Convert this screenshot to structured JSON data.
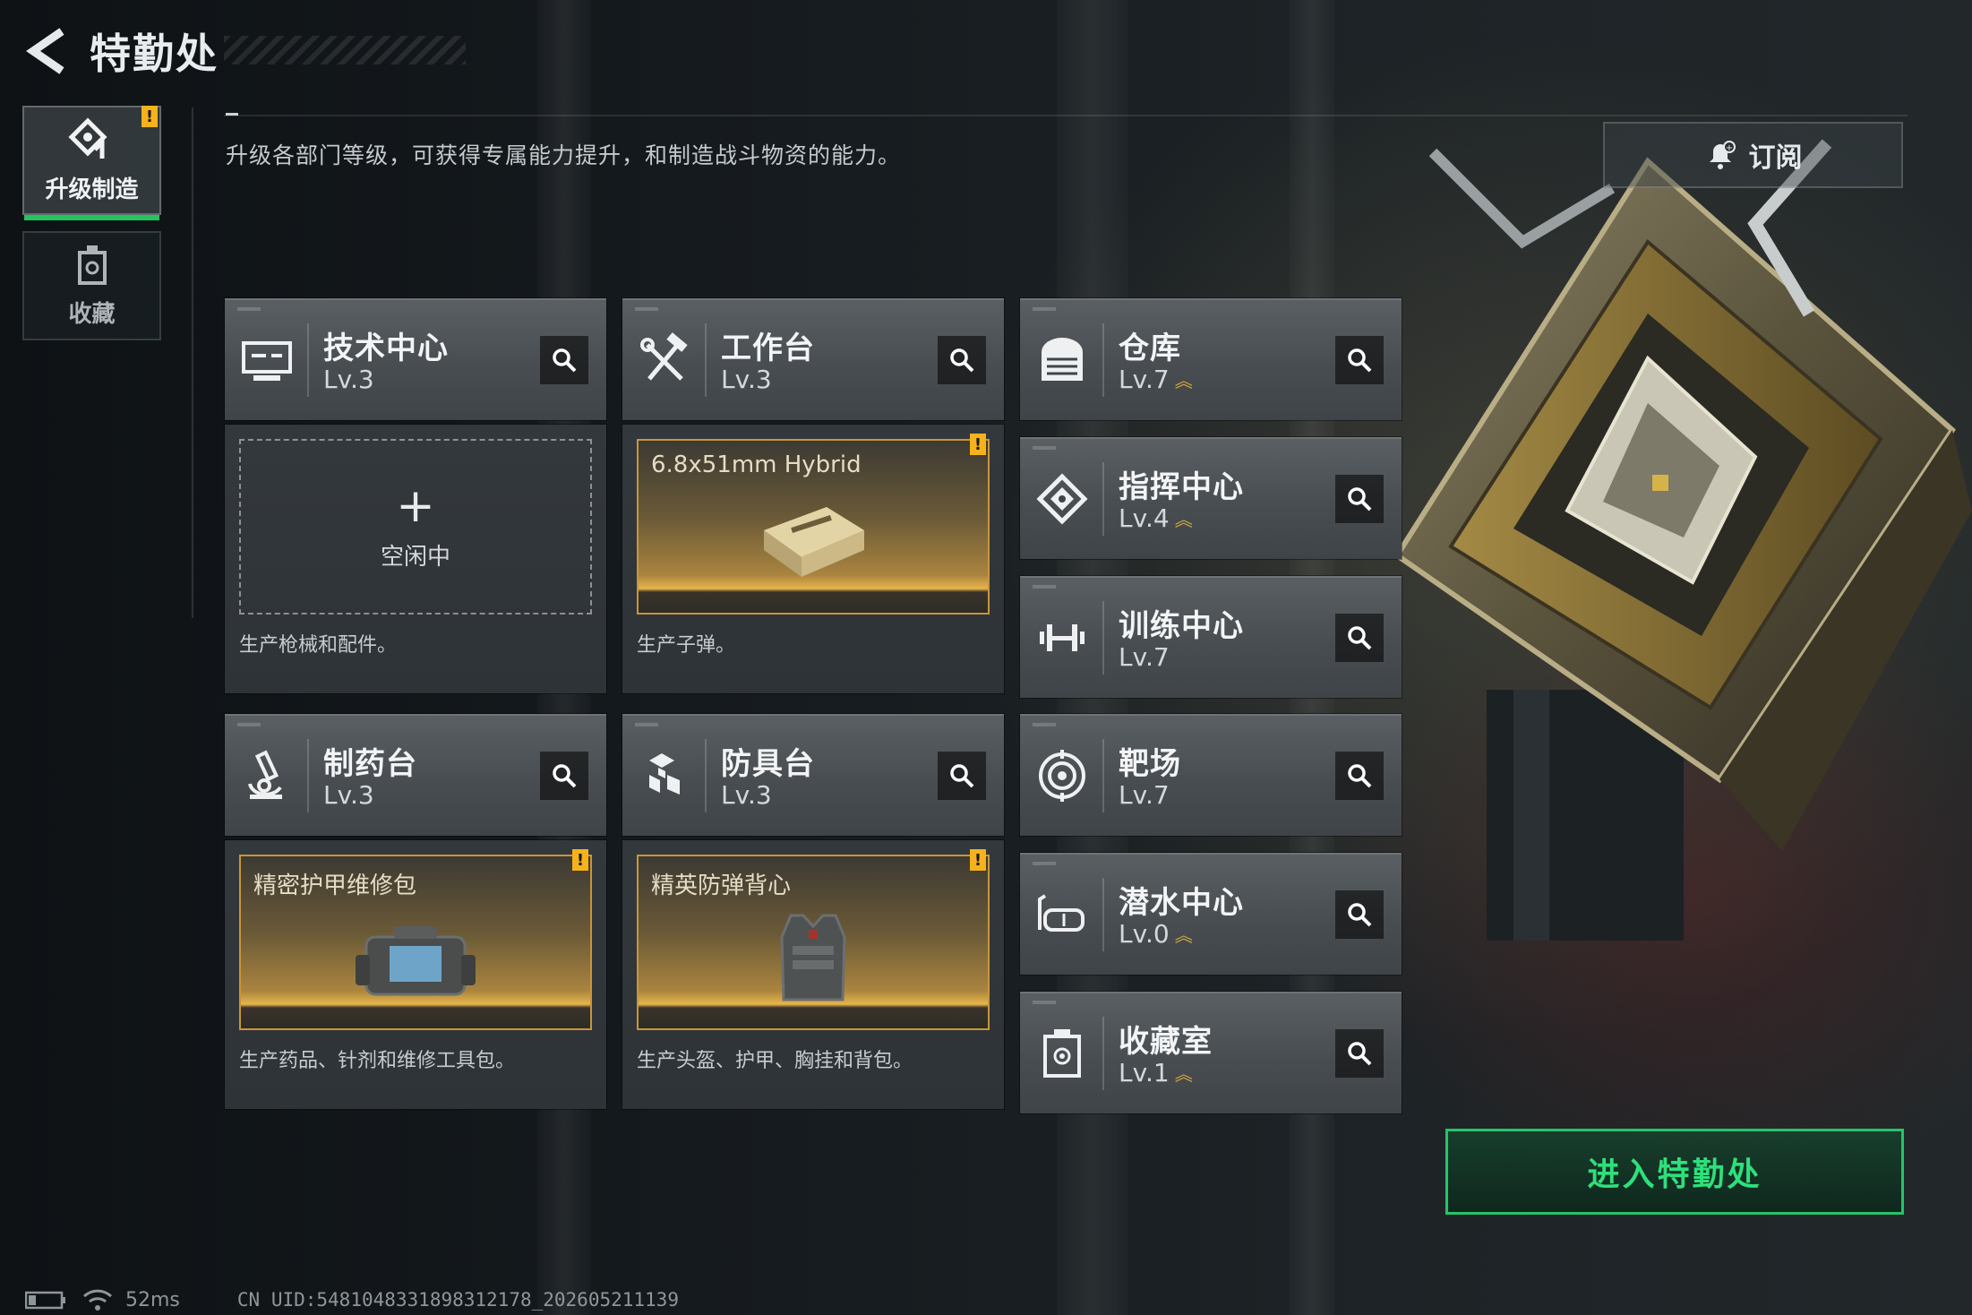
{
  "header": {
    "title": "特勤处"
  },
  "nav": {
    "tabs": [
      {
        "label": "升级制造",
        "active": true,
        "alert": "!"
      },
      {
        "label": "收藏",
        "active": false
      }
    ]
  },
  "description": "升级各部门等级，可获得专属能力提升，和制造战斗物资的能力。",
  "subscribe": {
    "label": "订阅"
  },
  "facilities": [
    {
      "name": "技术中心",
      "level": "Lv.3",
      "upgradable": false
    },
    {
      "name": "工作台",
      "level": "Lv.3",
      "upgradable": false
    },
    {
      "name": "仓库",
      "level": "Lv.7",
      "upgradable": true
    },
    {
      "name": "指挥中心",
      "level": "Lv.4",
      "upgradable": true
    },
    {
      "name": "训练中心",
      "level": "Lv.7",
      "upgradable": false
    },
    {
      "name": "制药台",
      "level": "Lv.3",
      "upgradable": false
    },
    {
      "name": "防具台",
      "level": "Lv.3",
      "upgradable": false
    },
    {
      "name": "靶场",
      "level": "Lv.7",
      "upgradable": false
    },
    {
      "name": "潜水中心",
      "level": "Lv.0",
      "upgradable": true
    },
    {
      "name": "收藏室",
      "level": "Lv.1",
      "upgradable": true
    }
  ],
  "production": [
    {
      "facility": "技术中心",
      "state": "空闲中",
      "item": "",
      "description": "生产枪械和配件。"
    },
    {
      "facility": "工作台",
      "state": "busy",
      "item": "6.8x51mm Hybrid",
      "alert": "!",
      "description": "生产子弹。"
    },
    {
      "facility": "制药台",
      "state": "busy",
      "item": "精密护甲维修包",
      "alert": "!",
      "description": "生产药品、针剂和维修工具包。"
    },
    {
      "facility": "防具台",
      "state": "busy",
      "item": "精英防弹背心",
      "alert": "!",
      "description": "生产头盔、护甲、胸挂和背包。"
    }
  ],
  "empty_slot": {
    "plus": "+"
  },
  "enter_button": {
    "label": "进入特勤处"
  },
  "status": {
    "ping": "52ms",
    "uid": "CN UID:5481048331898312178_202605211139"
  },
  "colors": {
    "accent_green": "#25c46a",
    "gold": "#e7b54b",
    "warning": "#f5b21a"
  },
  "icons": {
    "back": "back-arrow-icon",
    "upgrade": "upgrade-icon",
    "collection": "collection-icon",
    "bell": "bell-icon",
    "search": "search-icon"
  }
}
